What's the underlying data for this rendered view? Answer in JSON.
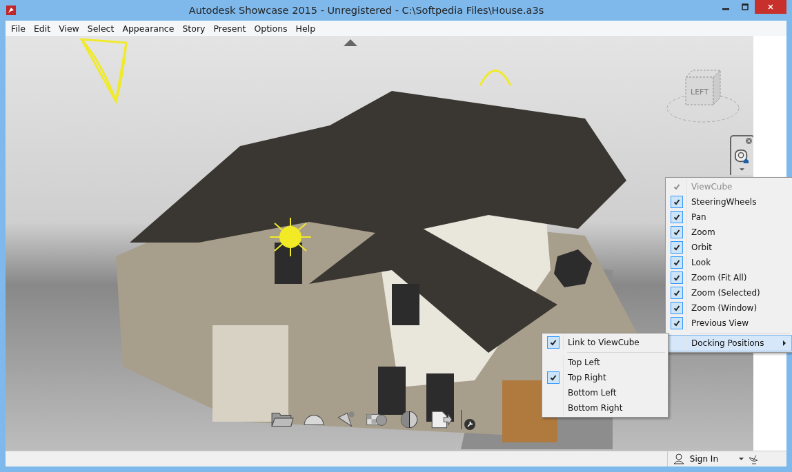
{
  "window": {
    "title": "Autodesk Showcase 2015 - Unregistered - C:\\Softpedia Files\\House.a3s"
  },
  "menu": [
    "File",
    "Edit",
    "View",
    "Select",
    "Appearance",
    "Story",
    "Present",
    "Options",
    "Help"
  ],
  "nav_menu": {
    "items": [
      {
        "kind": "check",
        "label": "ViewCube",
        "checked": true,
        "disabled": true
      },
      {
        "kind": "check",
        "label": "SteeringWheels",
        "checked": true,
        "disabled": false
      },
      {
        "kind": "check",
        "label": "Pan",
        "checked": true,
        "disabled": false
      },
      {
        "kind": "check",
        "label": "Zoom",
        "checked": true,
        "disabled": false
      },
      {
        "kind": "check",
        "label": "Orbit",
        "checked": true,
        "disabled": false
      },
      {
        "kind": "check",
        "label": "Look",
        "checked": true,
        "disabled": false
      },
      {
        "kind": "check",
        "label": "Zoom (Fit All)",
        "checked": true,
        "disabled": false
      },
      {
        "kind": "check",
        "label": "Zoom (Selected)",
        "checked": true,
        "disabled": false
      },
      {
        "kind": "check",
        "label": "Zoom (Window)",
        "checked": true,
        "disabled": false
      },
      {
        "kind": "check",
        "label": "Previous View",
        "checked": true,
        "disabled": false
      },
      {
        "kind": "separator"
      },
      {
        "kind": "submenu",
        "label": "Docking Positions",
        "highlighted": true
      }
    ]
  },
  "docking_menu": {
    "items": [
      {
        "kind": "check",
        "label": "Link to ViewCube",
        "checked": true
      },
      {
        "kind": "separator"
      },
      {
        "kind": "check",
        "label": "Top Left",
        "checked": false
      },
      {
        "kind": "check",
        "label": "Top Right",
        "checked": true
      },
      {
        "kind": "check",
        "label": "Bottom Left",
        "checked": false
      },
      {
        "kind": "check",
        "label": "Bottom Right",
        "checked": false
      }
    ]
  },
  "viewcube": {
    "face": "LEFT"
  },
  "status_bar": {
    "sign_in": "Sign In"
  }
}
